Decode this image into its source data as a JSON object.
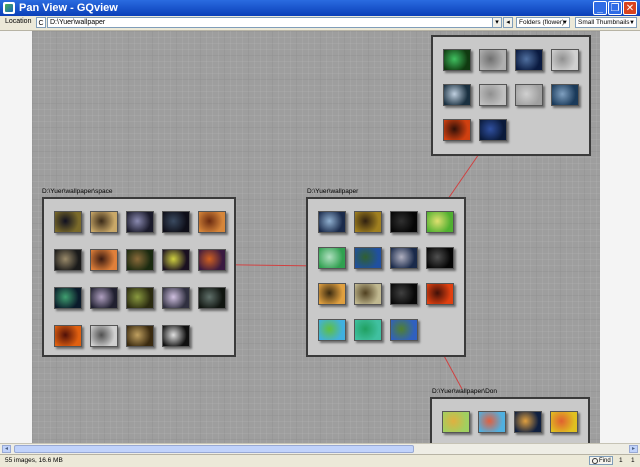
{
  "window": {
    "title": "Pan View - GQview",
    "minimize": "_",
    "maximize": "❐",
    "close": "✕"
  },
  "toolbar": {
    "location_label": "Location",
    "location_button": "C",
    "location_value": "D:\\Yuer\\wallpaper",
    "arrow_down": "▾",
    "go_arrow": "◂",
    "view_mode": "Folders (flower)",
    "thumb_size": "Small Thumbnails"
  },
  "groups": [
    {
      "id": "space",
      "label": "D:\\Yuer\\wallpaper\\space",
      "thumbs": [
        {
          "c1": "#7a6a2a",
          "c2": "#101020"
        },
        {
          "c1": "#c9a868",
          "c2": "#3a2a18"
        },
        {
          "c1": "#1a1a2a",
          "c2": "#8a8ab0"
        },
        {
          "c1": "#0e0e18",
          "c2": "#3a4a60"
        },
        {
          "c1": "#d6863a",
          "c2": "#6a2a10"
        },
        {
          "c1": "#1a1a1a",
          "c2": "#9a8a6a"
        },
        {
          "c1": "#e0803a",
          "c2": "#3a1a10"
        },
        {
          "c1": "#1a2a10",
          "c2": "#8a6a3a"
        },
        {
          "c1": "#1a1020",
          "c2": "#d0d040"
        },
        {
          "c1": "#3a1a40",
          "c2": "#d06020"
        },
        {
          "c1": "#0a1a2a",
          "c2": "#40a070"
        },
        {
          "c1": "#202030",
          "c2": "#b0a0c0"
        },
        {
          "c1": "#2a2a10",
          "c2": "#8a9a40"
        },
        {
          "c1": "#303040",
          "c2": "#d0c0e0"
        },
        {
          "c1": "#101510",
          "c2": "#60706a"
        },
        {
          "c1": "#e06010",
          "c2": "#501008"
        },
        {
          "c1": "#d0d0d0",
          "c2": "#505050"
        },
        {
          "c1": "#3a2a10",
          "c2": "#c0a060"
        },
        {
          "c1": "#101010",
          "c2": "#e0e0e0"
        }
      ]
    },
    {
      "id": "wallpaper",
      "label": "D:\\Yuer\\wallpaper",
      "thumbs": [
        {
          "c1": "#1a2a4a",
          "c2": "#90b0d0"
        },
        {
          "c1": "#a08020",
          "c2": "#302010"
        },
        {
          "c1": "#050505",
          "c2": "#303030"
        },
        {
          "c1": "#50b030",
          "c2": "#e0e070"
        },
        {
          "c1": "#30a050",
          "c2": "#b0e0c0"
        },
        {
          "c1": "#2050a0",
          "c2": "#306030"
        },
        {
          "c1": "#1a2a4a",
          "c2": "#b0b0c0"
        },
        {
          "c1": "#050505",
          "c2": "#505050"
        },
        {
          "c1": "#e0a040",
          "c2": "#3a2a10"
        },
        {
          "c1": "#c0b890",
          "c2": "#504020"
        },
        {
          "c1": "#080808",
          "c2": "#404040"
        },
        {
          "c1": "#e04010",
          "c2": "#401008"
        },
        {
          "c1": "#40b0e0",
          "c2": "#60c040"
        },
        {
          "c1": "#40c0a0",
          "c2": "#20a060"
        },
        {
          "c1": "#3060c0",
          "c2": "#508030"
        }
      ]
    },
    {
      "id": "top",
      "label": "",
      "thumbs": [
        {
          "c1": "#103a10",
          "c2": "#40c060"
        },
        {
          "c1": "#b0b0b0",
          "c2": "#707070"
        },
        {
          "c1": "#0a1a40",
          "c2": "#5070a0"
        },
        {
          "c1": "#d0d0d0",
          "c2": "#909090"
        },
        {
          "c1": "#1a3040",
          "c2": "#c0d0e0"
        },
        {
          "c1": "#c0c0c0",
          "c2": "#909090"
        },
        {
          "c1": "#a0a0a0",
          "c2": "#d0d0d0"
        },
        {
          "c1": "#1a3a5a",
          "c2": "#80a0c0"
        },
        {
          "c1": "#d04010",
          "c2": "#301008"
        },
        {
          "c1": "#0a1a3a",
          "c2": "#3050a0"
        }
      ]
    },
    {
      "id": "don",
      "label": "D:\\Yuer\\wallpaper\\Don",
      "thumbs": [
        {
          "c1": "#a0d060",
          "c2": "#e0b040"
        },
        {
          "c1": "#50b0e0",
          "c2": "#e06040"
        },
        {
          "c1": "#102040",
          "c2": "#e0a040"
        },
        {
          "c1": "#e0c020",
          "c2": "#e06030"
        }
      ]
    }
  ],
  "statusbar": {
    "status": "55 images, 16.6 MB",
    "find": "Find",
    "page_a": "1",
    "page_b": "1"
  }
}
